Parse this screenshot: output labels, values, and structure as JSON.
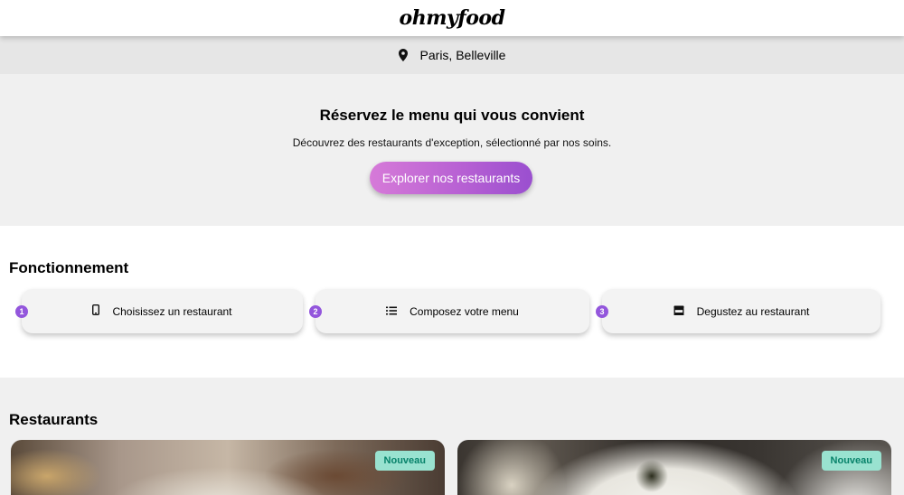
{
  "header": {
    "logo": "ohmyfood"
  },
  "location": {
    "icon": "map-pin-icon",
    "text": "Paris, Belleville"
  },
  "hero": {
    "title": "Réservez le menu qui vous convient",
    "subtitle": "Découvrez des restaurants d'exception, sélectionné par nos soins.",
    "cta_label": "Explorer nos restaurants"
  },
  "how_it_works": {
    "title": "Fonctionnement",
    "steps": [
      {
        "number": "1",
        "label": "Choisissez un restaurant",
        "icon": "mobile-phone-icon"
      },
      {
        "number": "2",
        "label": "Composez votre menu",
        "icon": "list-icon"
      },
      {
        "number": "3",
        "label": "Degustez au restaurant",
        "icon": "store-icon"
      }
    ]
  },
  "restaurants": {
    "title": "Restaurants",
    "cards": [
      {
        "badge": "Nouveau"
      },
      {
        "badge": "Nouveau"
      }
    ]
  },
  "colors": {
    "accent_purple": "#9356dc",
    "cta_gradient_start": "#d67ad8",
    "cta_gradient_end": "#9a4fcf",
    "badge_bg": "#99e2d0",
    "badge_text": "#07826a"
  }
}
